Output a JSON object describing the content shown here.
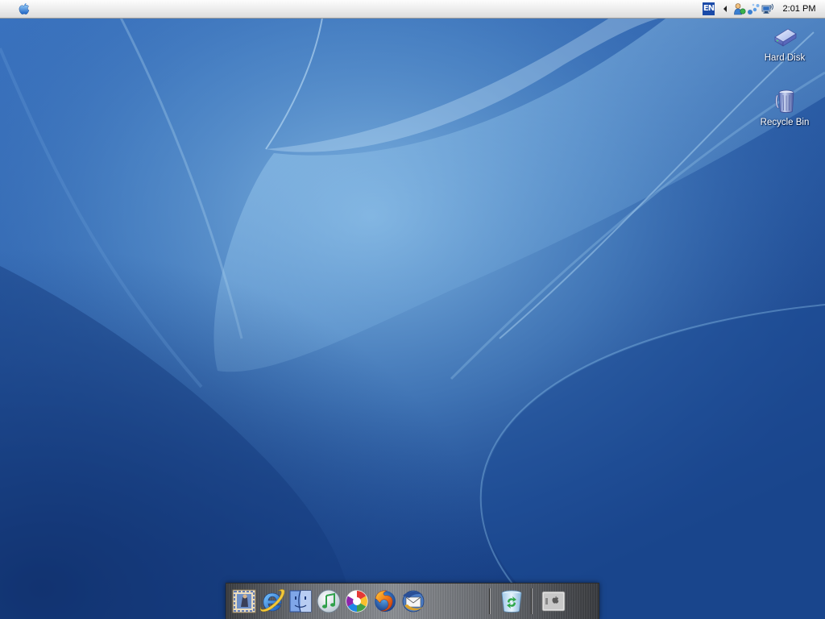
{
  "menubar": {
    "apple_icon": "apple-icon",
    "tray": {
      "language": "EN",
      "icons": [
        "show-hidden-icons-arrow-icon",
        "user-status-icon",
        "bluetooth-network-icon",
        "network-connection-icon"
      ],
      "clock": "2:01 PM"
    }
  },
  "desktop": {
    "icons": [
      {
        "label": "Hard Disk",
        "icon": "hard-disk-icon"
      },
      {
        "label": "Recycle Bin",
        "icon": "recycle-bin-icon"
      }
    ]
  },
  "dock": {
    "items": [
      {
        "icon": "mail-icon"
      },
      {
        "icon": "internet-explorer-icon"
      },
      {
        "icon": "finder-icon"
      },
      {
        "icon": "itunes-icon"
      },
      {
        "icon": "picasa-icon"
      },
      {
        "icon": "firefox-icon"
      },
      {
        "icon": "thunderbird-icon"
      },
      {
        "icon": "trash-icon"
      },
      {
        "icon": "system-preferences-icon"
      }
    ]
  },
  "colors": {
    "desktop_base": "#2a5da8",
    "desktop_light": "#7fb3e0",
    "desktop_dark": "#102f6e",
    "menubar": "#ececec",
    "dock_metal": "#8c8f94"
  }
}
